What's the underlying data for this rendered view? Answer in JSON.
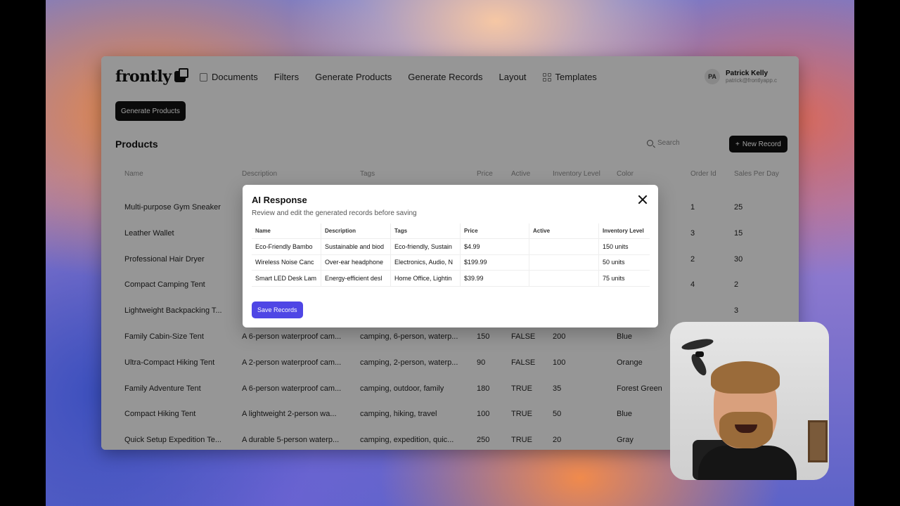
{
  "app": {
    "logo": "frontly",
    "nav": [
      {
        "label": "Documents",
        "icon": "document-icon"
      },
      {
        "label": "Filters"
      },
      {
        "label": "Generate Products"
      },
      {
        "label": "Generate Records"
      },
      {
        "label": "Layout"
      },
      {
        "label": "Templates",
        "icon": "grid-icon"
      }
    ],
    "user": {
      "initials": "PA",
      "name": "Patrick Kelly",
      "email": "patrick@frontlyapp.c"
    },
    "generate_button": "Generate Products",
    "section_title": "Products",
    "search_placeholder": "Search",
    "new_record_button": "New Record",
    "table": {
      "headers": [
        "Name",
        "Description",
        "Tags",
        "Price",
        "Active",
        "Inventory Level",
        "Color",
        "Order Id",
        "Sales Per Day"
      ],
      "rows": [
        [
          "Multi-purpose Gym Sneaker",
          "",
          "",
          "",
          "",
          "",
          "",
          "1",
          "25"
        ],
        [
          "Leather Wallet",
          "",
          "",
          "",
          "",
          "",
          "",
          "3",
          "15"
        ],
        [
          "Professional Hair Dryer",
          "",
          "",
          "",
          "",
          "",
          "",
          "2",
          "30"
        ],
        [
          "Compact Camping Tent",
          "",
          "",
          "",
          "",
          "",
          "",
          "4",
          "2"
        ],
        [
          "Lightweight Backpacking T...",
          "",
          "",
          "",
          "",
          "",
          "",
          "",
          "3"
        ],
        [
          "Family Cabin-Size Tent",
          "A 6-person waterproof cam...",
          "camping, 6-person, waterp...",
          "150",
          "FALSE",
          "200",
          "Blue",
          "",
          ""
        ],
        [
          "Ultra-Compact Hiking Tent",
          "A 2-person waterproof cam...",
          "camping, 2-person, waterp...",
          "90",
          "FALSE",
          "100",
          "Orange",
          "",
          ""
        ],
        [
          "Family Adventure Tent",
          "A 6-person waterproof cam...",
          "camping, outdoor, family",
          "180",
          "TRUE",
          "35",
          "Forest Green",
          "",
          ""
        ],
        [
          "Compact Hiking Tent",
          "A lightweight 2-person wa...",
          "camping, hiking, travel",
          "100",
          "TRUE",
          "50",
          "Blue",
          "",
          ""
        ],
        [
          "Quick Setup Expedition Te...",
          "A durable 5-person waterp...",
          "camping, expedition, quic...",
          "250",
          "TRUE",
          "20",
          "Gray",
          "",
          ""
        ]
      ]
    }
  },
  "modal": {
    "title": "AI Response",
    "subtitle": "Review and edit the generated records before saving",
    "headers": [
      "Name",
      "Description",
      "Tags",
      "Price",
      "Active",
      "Inventory Level"
    ],
    "rows": [
      [
        "Eco-Friendly Bambo",
        "Sustainable and biod",
        "Eco-friendly, Sustain",
        "$4.99",
        "",
        "150 units"
      ],
      [
        "Wireless Noise Canc",
        "Over-ear headphone",
        "Electronics, Audio, N",
        "$199.99",
        "",
        "50 units"
      ],
      [
        "Smart LED Desk Lam",
        "Energy-efficient desl",
        "Home Office, Lightin",
        "$39.99",
        "",
        "75 units"
      ]
    ],
    "save_button": "Save Records",
    "accent_color": "#4f46e5"
  }
}
